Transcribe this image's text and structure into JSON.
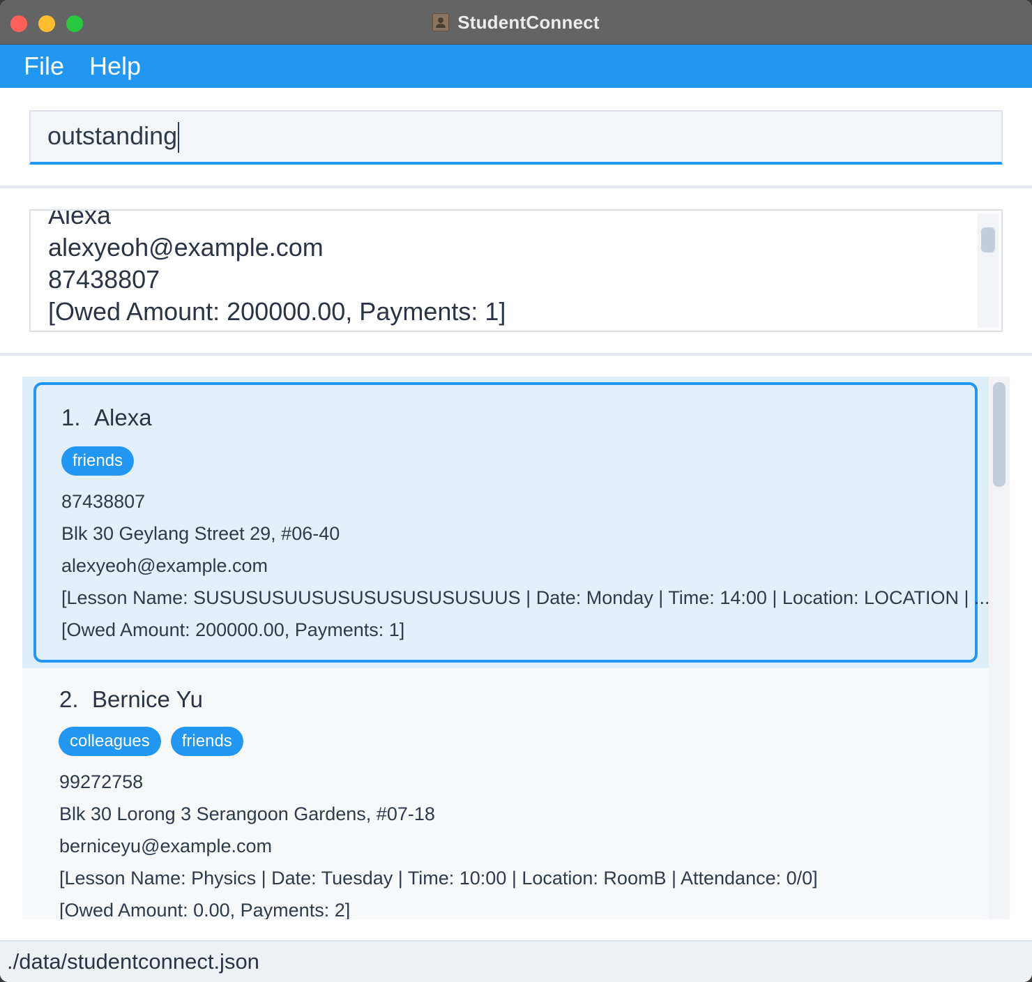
{
  "window": {
    "title": "StudentConnect"
  },
  "menu": {
    "file": "File",
    "help": "Help"
  },
  "command": {
    "value": "outstanding"
  },
  "result": {
    "lines": [
      "Alexa",
      "alexyeoh@example.com",
      "87438807",
      "[Owed Amount: 200000.00, Payments: 1]"
    ]
  },
  "persons": [
    {
      "index": "1.",
      "name": "Alexa",
      "tags": [
        "friends"
      ],
      "phone": "87438807",
      "address": "Blk 30 Geylang Street 29, #06-40",
      "email": "alexyeoh@example.com",
      "lesson": "[Lesson Name: SUSUSUSUUSUSUSUSUSUSUSUUS | Date: Monday | Time: 14:00 | Location: LOCATION | ...",
      "payment": "[Owed Amount: 200000.00, Payments: 1]"
    },
    {
      "index": "2.",
      "name": "Bernice Yu",
      "tags": [
        "colleagues",
        "friends"
      ],
      "phone": "99272758",
      "address": "Blk 30 Lorong 3 Serangoon Gardens, #07-18",
      "email": "berniceyu@example.com",
      "lesson": "[Lesson Name: Physics | Date: Tuesday | Time: 10:00 | Location: RoomB | Attendance: 0/0]",
      "payment": "[Owed Amount: 0.00, Payments: 2]"
    }
  ],
  "status": {
    "path": "./data/studentconnect.json"
  },
  "colors": {
    "accent": "#2196f3",
    "selected_bg": "#e3f0fb",
    "titlebar": "#646464"
  }
}
